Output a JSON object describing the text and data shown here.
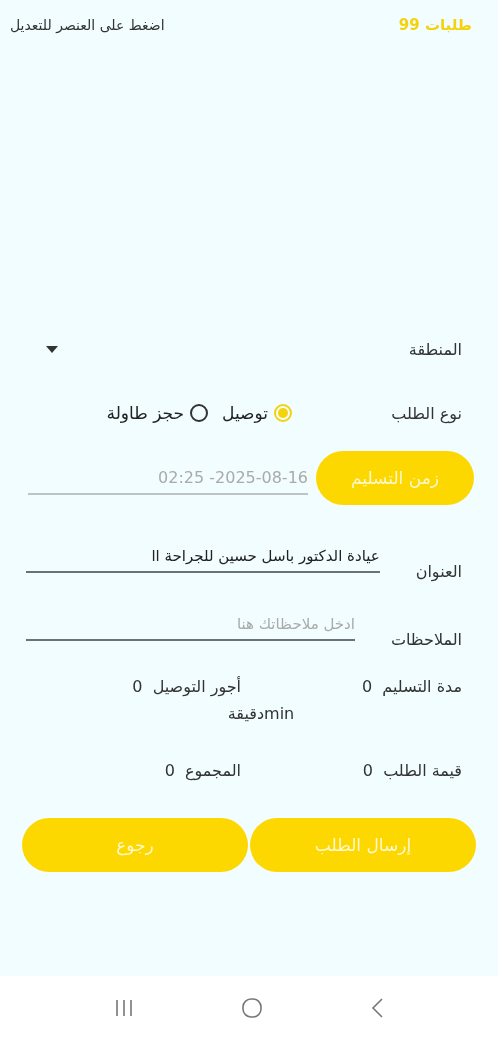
{
  "header": {
    "title": "طلبات 99",
    "hint": "اضغط على العنصر للتعديل"
  },
  "region": {
    "label": "المنطقة"
  },
  "order_type": {
    "label": "نوع الطلب",
    "options": [
      {
        "label": "توصيل",
        "selected": true
      },
      {
        "label": "حجز طاولة",
        "selected": false
      }
    ]
  },
  "delivery_time": {
    "button": "زمن التسليم",
    "value": "02:25 -2025-08-16"
  },
  "address": {
    "label": "العنوان",
    "value": "عيادة الدكتور باسل حسين للجراحة اا"
  },
  "notes": {
    "label": "الملاحظات",
    "placeholder": "ادخل ملاحظاتك هنا"
  },
  "stats": [
    {
      "label": "مدة التسليم",
      "value": "0"
    },
    {
      "label": "أجور التوصيل",
      "value": "0"
    }
  ],
  "duration_unit": "minدقيقة",
  "totals": [
    {
      "label": "قيمة الطلب",
      "value": "0"
    },
    {
      "label": "المجموع",
      "value": "0"
    }
  ],
  "buttons": [
    "إرسال الطلب",
    "رجوع"
  ]
}
